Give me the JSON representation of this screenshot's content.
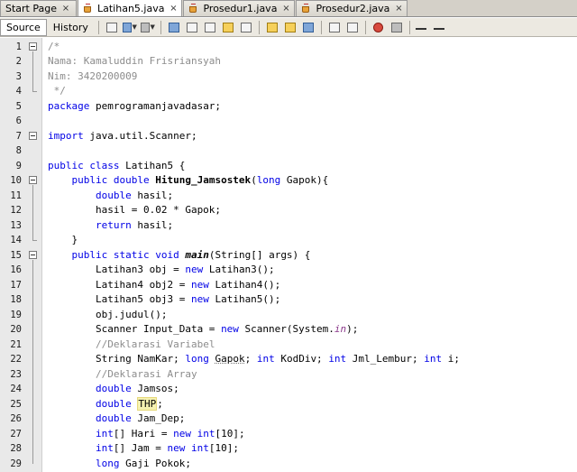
{
  "tabs": [
    {
      "label": "Start Page",
      "icon": "none",
      "closable": true,
      "active": false
    },
    {
      "label": "Latihan5.java",
      "icon": "java-file-icon",
      "closable": true,
      "active": true
    },
    {
      "label": "Prosedur1.java",
      "icon": "java-file-icon",
      "closable": true,
      "active": false
    },
    {
      "label": "Prosedur2.java",
      "icon": "java-file-icon",
      "closable": true,
      "active": false
    }
  ],
  "close_glyph": "×",
  "toolbar": {
    "source_label": "Source",
    "history_label": "History"
  },
  "code": [
    {
      "n": "1",
      "tokens": [
        [
          "cm",
          "/*"
        ]
      ]
    },
    {
      "n": "2",
      "tokens": [
        [
          "cm",
          "Nama: Kamaluddin Frisriansyah"
        ]
      ]
    },
    {
      "n": "3",
      "tokens": [
        [
          "cm",
          "Nim: 3420200009"
        ]
      ]
    },
    {
      "n": "4",
      "tokens": [
        [
          "cm",
          " */"
        ]
      ]
    },
    {
      "n": "5",
      "tokens": [
        [
          "kw",
          "package"
        ],
        [
          "",
          " pemrogramanjavadasar;"
        ]
      ]
    },
    {
      "n": "6",
      "tokens": []
    },
    {
      "n": "7",
      "tokens": [
        [
          "kw",
          "import"
        ],
        [
          "",
          " java.util.Scanner;"
        ]
      ]
    },
    {
      "n": "8",
      "tokens": []
    },
    {
      "n": "9",
      "tokens": [
        [
          "kw",
          "public class"
        ],
        [
          "",
          " Latihan5 {"
        ]
      ]
    },
    {
      "n": "10",
      "tokens": [
        [
          "",
          "    "
        ],
        [
          "kw",
          "public double"
        ],
        [
          "",
          " "
        ],
        [
          "fn",
          "Hitung_Jamsostek"
        ],
        [
          "",
          "("
        ],
        [
          "kw",
          "long"
        ],
        [
          "",
          " Gapok){"
        ]
      ]
    },
    {
      "n": "11",
      "tokens": [
        [
          "",
          "        "
        ],
        [
          "kw",
          "double"
        ],
        [
          "",
          " hasil;"
        ]
      ]
    },
    {
      "n": "12",
      "tokens": [
        [
          "",
          "        hasil = 0.02 * Gapok;"
        ]
      ]
    },
    {
      "n": "13",
      "tokens": [
        [
          "",
          "        "
        ],
        [
          "kw",
          "return"
        ],
        [
          "",
          " hasil;"
        ]
      ]
    },
    {
      "n": "14",
      "tokens": [
        [
          "",
          "    }"
        ]
      ]
    },
    {
      "n": "15",
      "tokens": [
        [
          "",
          "    "
        ],
        [
          "kw",
          "public static void"
        ],
        [
          "",
          " "
        ],
        [
          "it",
          "main"
        ],
        [
          "",
          "(String[] args) {"
        ]
      ]
    },
    {
      "n": "16",
      "tokens": [
        [
          "",
          "        Latihan3 obj = "
        ],
        [
          "kw",
          "new"
        ],
        [
          "",
          " Latihan3();"
        ]
      ]
    },
    {
      "n": "17",
      "tokens": [
        [
          "",
          "        Latihan4 obj2 = "
        ],
        [
          "kw",
          "new"
        ],
        [
          "",
          " Latihan4();"
        ]
      ]
    },
    {
      "n": "18",
      "tokens": [
        [
          "",
          "        Latihan5 obj3 = "
        ],
        [
          "kw",
          "new"
        ],
        [
          "",
          " Latihan5();"
        ]
      ]
    },
    {
      "n": "19",
      "tokens": [
        [
          "",
          "        obj.judul();"
        ]
      ]
    },
    {
      "n": "20",
      "tokens": [
        [
          "",
          "        Scanner Input_Data = "
        ],
        [
          "kw",
          "new"
        ],
        [
          "",
          " Scanner(System."
        ],
        [
          "st",
          "in"
        ],
        [
          "",
          ");"
        ]
      ]
    },
    {
      "n": "21",
      "tokens": [
        [
          "",
          "        "
        ],
        [
          "cm",
          "//Deklarasi Variabel"
        ]
      ]
    },
    {
      "n": "22",
      "tokens": [
        [
          "",
          "        String NamKar; "
        ],
        [
          "kw",
          "long"
        ],
        [
          "",
          " "
        ],
        [
          "ul",
          "Gapok"
        ],
        [
          "",
          "; "
        ],
        [
          "kw",
          "int"
        ],
        [
          "",
          " KodDiv; "
        ],
        [
          "kw",
          "int"
        ],
        [
          "",
          " Jml_Lembur; "
        ],
        [
          "kw",
          "int"
        ],
        [
          "",
          " i;"
        ]
      ]
    },
    {
      "n": "23",
      "tokens": [
        [
          "",
          "        "
        ],
        [
          "cm",
          "//Deklarasi Array"
        ]
      ]
    },
    {
      "n": "24",
      "tokens": [
        [
          "",
          "        "
        ],
        [
          "kw",
          "double"
        ],
        [
          "",
          " Jamsos;"
        ]
      ]
    },
    {
      "n": "25",
      "tokens": [
        [
          "",
          "        "
        ],
        [
          "kw",
          "double"
        ],
        [
          "",
          " "
        ],
        [
          "hl",
          "THP"
        ],
        [
          "",
          ";"
        ]
      ]
    },
    {
      "n": "26",
      "tokens": [
        [
          "",
          "        "
        ],
        [
          "kw",
          "double"
        ],
        [
          "",
          " Jam_Dep;"
        ]
      ]
    },
    {
      "n": "27",
      "tokens": [
        [
          "",
          "        "
        ],
        [
          "kw",
          "int"
        ],
        [
          "",
          "[] Hari = "
        ],
        [
          "kw",
          "new"
        ],
        [
          "",
          " "
        ],
        [
          "kw",
          "int"
        ],
        [
          "",
          "[10];"
        ]
      ]
    },
    {
      "n": "28",
      "tokens": [
        [
          "",
          "        "
        ],
        [
          "kw",
          "int"
        ],
        [
          "",
          "[] Jam = "
        ],
        [
          "kw",
          "new"
        ],
        [
          "",
          " "
        ],
        [
          "kw",
          "int"
        ],
        [
          "",
          "[10];"
        ]
      ]
    },
    {
      "n": "29",
      "tokens": [
        [
          "",
          "        "
        ],
        [
          "kw",
          "long"
        ],
        [
          "",
          " Gaji Pokok;"
        ]
      ]
    }
  ]
}
